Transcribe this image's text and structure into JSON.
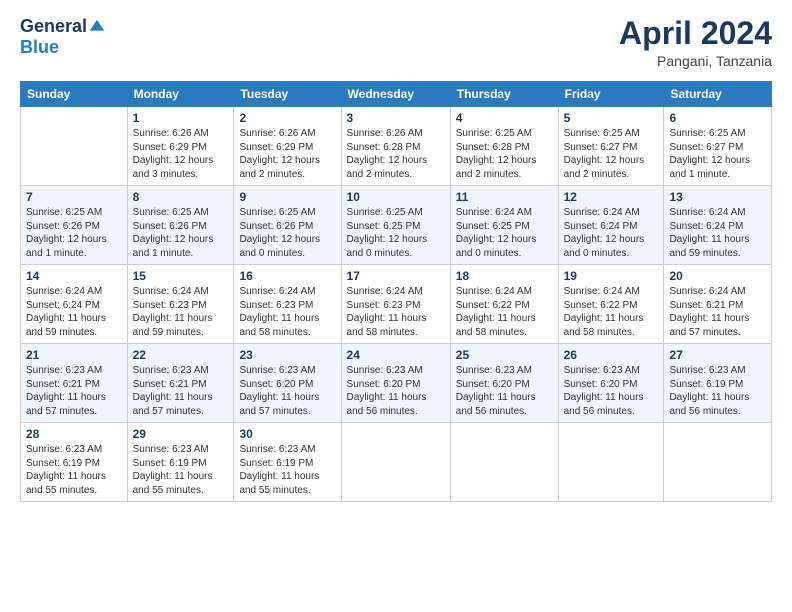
{
  "header": {
    "logo": {
      "general": "General",
      "blue": "Blue"
    },
    "title": "April 2024",
    "location": "Pangani, Tanzania"
  },
  "weekdays": [
    "Sunday",
    "Monday",
    "Tuesday",
    "Wednesday",
    "Thursday",
    "Friday",
    "Saturday"
  ],
  "weeks": [
    [
      {
        "day": "",
        "sunrise": "",
        "sunset": "",
        "daylight": ""
      },
      {
        "day": "1",
        "sunrise": "Sunrise: 6:26 AM",
        "sunset": "Sunset: 6:29 PM",
        "daylight": "Daylight: 12 hours and 3 minutes."
      },
      {
        "day": "2",
        "sunrise": "Sunrise: 6:26 AM",
        "sunset": "Sunset: 6:29 PM",
        "daylight": "Daylight: 12 hours and 2 minutes."
      },
      {
        "day": "3",
        "sunrise": "Sunrise: 6:26 AM",
        "sunset": "Sunset: 6:28 PM",
        "daylight": "Daylight: 12 hours and 2 minutes."
      },
      {
        "day": "4",
        "sunrise": "Sunrise: 6:25 AM",
        "sunset": "Sunset: 6:28 PM",
        "daylight": "Daylight: 12 hours and 2 minutes."
      },
      {
        "day": "5",
        "sunrise": "Sunrise: 6:25 AM",
        "sunset": "Sunset: 6:27 PM",
        "daylight": "Daylight: 12 hours and 2 minutes."
      },
      {
        "day": "6",
        "sunrise": "Sunrise: 6:25 AM",
        "sunset": "Sunset: 6:27 PM",
        "daylight": "Daylight: 12 hours and 1 minute."
      }
    ],
    [
      {
        "day": "7",
        "sunrise": "Sunrise: 6:25 AM",
        "sunset": "Sunset: 6:26 PM",
        "daylight": "Daylight: 12 hours and 1 minute."
      },
      {
        "day": "8",
        "sunrise": "Sunrise: 6:25 AM",
        "sunset": "Sunset: 6:26 PM",
        "daylight": "Daylight: 12 hours and 1 minute."
      },
      {
        "day": "9",
        "sunrise": "Sunrise: 6:25 AM",
        "sunset": "Sunset: 6:26 PM",
        "daylight": "Daylight: 12 hours and 0 minutes."
      },
      {
        "day": "10",
        "sunrise": "Sunrise: 6:25 AM",
        "sunset": "Sunset: 6:25 PM",
        "daylight": "Daylight: 12 hours and 0 minutes."
      },
      {
        "day": "11",
        "sunrise": "Sunrise: 6:24 AM",
        "sunset": "Sunset: 6:25 PM",
        "daylight": "Daylight: 12 hours and 0 minutes."
      },
      {
        "day": "12",
        "sunrise": "Sunrise: 6:24 AM",
        "sunset": "Sunset: 6:24 PM",
        "daylight": "Daylight: 12 hours and 0 minutes."
      },
      {
        "day": "13",
        "sunrise": "Sunrise: 6:24 AM",
        "sunset": "Sunset: 6:24 PM",
        "daylight": "Daylight: 11 hours and 59 minutes."
      }
    ],
    [
      {
        "day": "14",
        "sunrise": "Sunrise: 6:24 AM",
        "sunset": "Sunset: 6:24 PM",
        "daylight": "Daylight: 11 hours and 59 minutes."
      },
      {
        "day": "15",
        "sunrise": "Sunrise: 6:24 AM",
        "sunset": "Sunset: 6:23 PM",
        "daylight": "Daylight: 11 hours and 59 minutes."
      },
      {
        "day": "16",
        "sunrise": "Sunrise: 6:24 AM",
        "sunset": "Sunset: 6:23 PM",
        "daylight": "Daylight: 11 hours and 58 minutes."
      },
      {
        "day": "17",
        "sunrise": "Sunrise: 6:24 AM",
        "sunset": "Sunset: 6:23 PM",
        "daylight": "Daylight: 11 hours and 58 minutes."
      },
      {
        "day": "18",
        "sunrise": "Sunrise: 6:24 AM",
        "sunset": "Sunset: 6:22 PM",
        "daylight": "Daylight: 11 hours and 58 minutes."
      },
      {
        "day": "19",
        "sunrise": "Sunrise: 6:24 AM",
        "sunset": "Sunset: 6:22 PM",
        "daylight": "Daylight: 11 hours and 58 minutes."
      },
      {
        "day": "20",
        "sunrise": "Sunrise: 6:24 AM",
        "sunset": "Sunset: 6:21 PM",
        "daylight": "Daylight: 11 hours and 57 minutes."
      }
    ],
    [
      {
        "day": "21",
        "sunrise": "Sunrise: 6:23 AM",
        "sunset": "Sunset: 6:21 PM",
        "daylight": "Daylight: 11 hours and 57 minutes."
      },
      {
        "day": "22",
        "sunrise": "Sunrise: 6:23 AM",
        "sunset": "Sunset: 6:21 PM",
        "daylight": "Daylight: 11 hours and 57 minutes."
      },
      {
        "day": "23",
        "sunrise": "Sunrise: 6:23 AM",
        "sunset": "Sunset: 6:20 PM",
        "daylight": "Daylight: 11 hours and 57 minutes."
      },
      {
        "day": "24",
        "sunrise": "Sunrise: 6:23 AM",
        "sunset": "Sunset: 6:20 PM",
        "daylight": "Daylight: 11 hours and 56 minutes."
      },
      {
        "day": "25",
        "sunrise": "Sunrise: 6:23 AM",
        "sunset": "Sunset: 6:20 PM",
        "daylight": "Daylight: 11 hours and 56 minutes."
      },
      {
        "day": "26",
        "sunrise": "Sunrise: 6:23 AM",
        "sunset": "Sunset: 6:20 PM",
        "daylight": "Daylight: 11 hours and 56 minutes."
      },
      {
        "day": "27",
        "sunrise": "Sunrise: 6:23 AM",
        "sunset": "Sunset: 6:19 PM",
        "daylight": "Daylight: 11 hours and 56 minutes."
      }
    ],
    [
      {
        "day": "28",
        "sunrise": "Sunrise: 6:23 AM",
        "sunset": "Sunset: 6:19 PM",
        "daylight": "Daylight: 11 hours and 55 minutes."
      },
      {
        "day": "29",
        "sunrise": "Sunrise: 6:23 AM",
        "sunset": "Sunset: 6:19 PM",
        "daylight": "Daylight: 11 hours and 55 minutes."
      },
      {
        "day": "30",
        "sunrise": "Sunrise: 6:23 AM",
        "sunset": "Sunset: 6:19 PM",
        "daylight": "Daylight: 11 hours and 55 minutes."
      },
      {
        "day": "",
        "sunrise": "",
        "sunset": "",
        "daylight": ""
      },
      {
        "day": "",
        "sunrise": "",
        "sunset": "",
        "daylight": ""
      },
      {
        "day": "",
        "sunrise": "",
        "sunset": "",
        "daylight": ""
      },
      {
        "day": "",
        "sunrise": "",
        "sunset": "",
        "daylight": ""
      }
    ]
  ]
}
